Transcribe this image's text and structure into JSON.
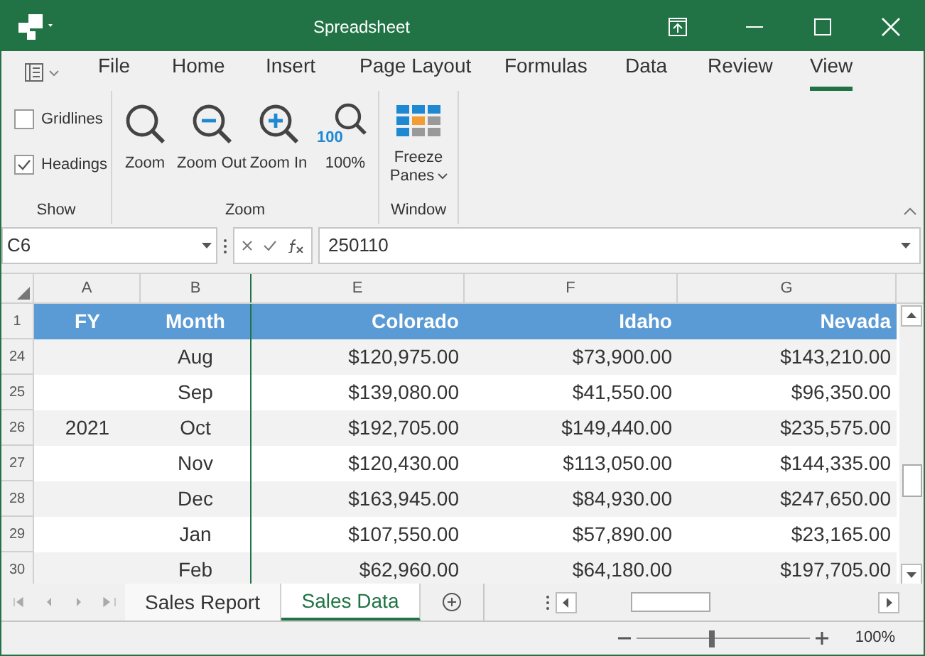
{
  "window": {
    "title": "Spreadsheet"
  },
  "menu_tabs": [
    {
      "label": "File",
      "selected": false
    },
    {
      "label": "Home",
      "selected": false
    },
    {
      "label": "Insert",
      "selected": false
    },
    {
      "label": "Page Layout",
      "selected": false
    },
    {
      "label": "Formulas",
      "selected": false
    },
    {
      "label": "Data",
      "selected": false
    },
    {
      "label": "Review",
      "selected": false
    },
    {
      "label": "View",
      "selected": true
    }
  ],
  "ribbon": {
    "groups": [
      {
        "label": "Show",
        "items": [
          {
            "kind": "checkbox",
            "label": "Gridlines",
            "checked": false
          },
          {
            "kind": "checkbox",
            "label": "Headings",
            "checked": true
          }
        ]
      },
      {
        "label": "Zoom",
        "items": [
          {
            "kind": "zoom",
            "label": "Zoom"
          },
          {
            "kind": "zoom-out",
            "label": "Zoom Out"
          },
          {
            "kind": "zoom-in",
            "label": "Zoom In"
          },
          {
            "kind": "zoom-100",
            "label": "100%",
            "badge": "100"
          }
        ]
      },
      {
        "label": "Window",
        "items": [
          {
            "kind": "freeze",
            "label": "Freeze",
            "label_2": "Panes"
          }
        ]
      }
    ]
  },
  "formula_bar": {
    "name_box": "C6",
    "value": "250110"
  },
  "columns": [
    "A",
    "B",
    "E",
    "F",
    "G"
  ],
  "header_row": {
    "row": "1",
    "cells": [
      "FY",
      "Month",
      "Colorado",
      "Idaho",
      "Nevada"
    ]
  },
  "rows": [
    {
      "row": "24",
      "cells": [
        "",
        "Aug",
        "$120,975.00",
        "$73,900.00",
        "$143,210.00"
      ]
    },
    {
      "row": "25",
      "cells": [
        "",
        "Sep",
        "$139,080.00",
        "$41,550.00",
        "$96,350.00"
      ]
    },
    {
      "row": "26",
      "cells": [
        "2021",
        "Oct",
        "$192,705.00",
        "$149,440.00",
        "$235,575.00"
      ]
    },
    {
      "row": "27",
      "cells": [
        "",
        "Nov",
        "$120,430.00",
        "$113,050.00",
        "$144,335.00"
      ]
    },
    {
      "row": "28",
      "cells": [
        "",
        "Dec",
        "$163,945.00",
        "$84,930.00",
        "$247,650.00"
      ]
    },
    {
      "row": "29",
      "cells": [
        "",
        "Jan",
        "$107,550.00",
        "$57,890.00",
        "$23,165.00"
      ]
    },
    {
      "row": "30",
      "cells": [
        "",
        "Feb",
        "$62,960.00",
        "$64,180.00",
        "$197,705.00"
      ]
    }
  ],
  "sheet_tabs": [
    {
      "label": "Sales Report",
      "selected": false
    },
    {
      "label": "Sales Data",
      "selected": true
    }
  ],
  "status_bar": {
    "zoom": {
      "level": 0.43,
      "reading": "100%"
    }
  }
}
